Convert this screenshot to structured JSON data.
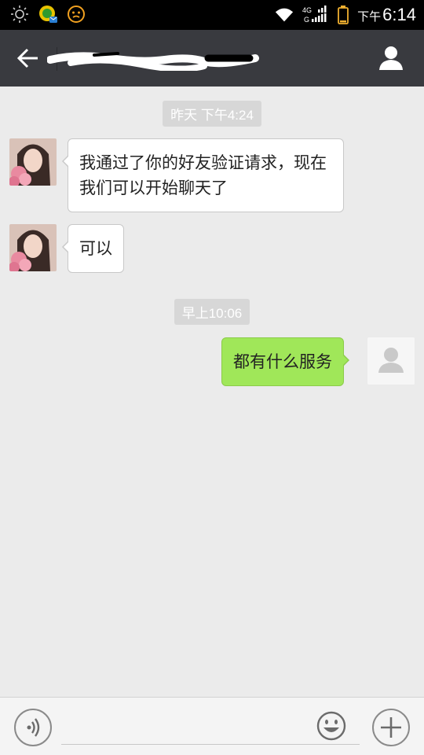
{
  "status_bar": {
    "network": "4G",
    "ampm": "下午",
    "time": "6:14",
    "icons": [
      "brightness-icon",
      "app-notification-icon",
      "face-notification-icon",
      "wifi-icon",
      "signal-icon",
      "battery-icon"
    ]
  },
  "header": {
    "title": "",
    "back_icon": "back-arrow-icon",
    "contact_icon": "contact-person-icon"
  },
  "timestamps": [
    "昨天 下午4:24",
    "早上10:06"
  ],
  "messages": [
    {
      "direction": "in",
      "text": "我通过了你的好友验证请求，现在我们可以开始聊天了"
    },
    {
      "direction": "in",
      "text": "可以"
    },
    {
      "direction": "out",
      "text": "都有什么服务"
    }
  ],
  "input_bar": {
    "placeholder": "",
    "voice_icon": "voice-icon",
    "emoji_icon": "emoji-icon",
    "plus_icon": "plus-icon"
  },
  "colors": {
    "header_bg": "#393a3f",
    "chat_bg": "#ebebeb",
    "outgoing_bubble": "#a0e759",
    "incoming_bubble": "#ffffff",
    "timestamp_bg": "#d7d7d7"
  }
}
